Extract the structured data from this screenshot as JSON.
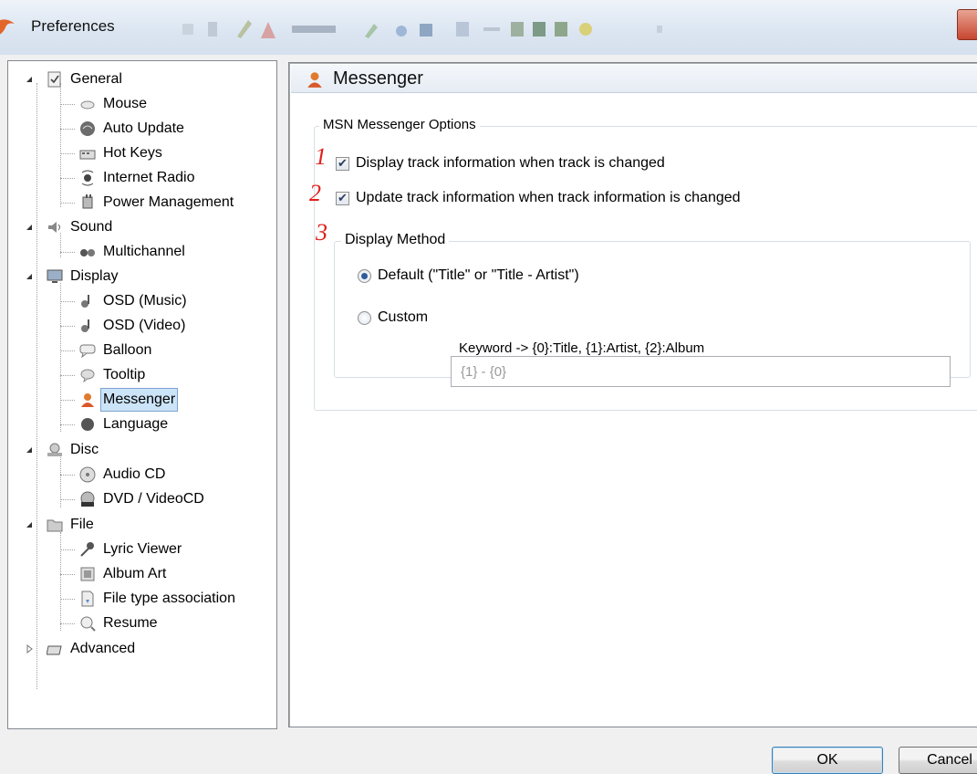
{
  "window": {
    "title": "Preferences"
  },
  "tree": {
    "general": {
      "label": "General",
      "children": [
        "Mouse",
        "Auto Update",
        "Hot Keys",
        "Internet Radio",
        "Power Management"
      ]
    },
    "sound": {
      "label": "Sound",
      "children": [
        "Multichannel"
      ]
    },
    "display": {
      "label": "Display",
      "children": [
        "OSD (Music)",
        "OSD (Video)",
        "Balloon",
        "Tooltip",
        "Messenger",
        "Language"
      ]
    },
    "disc": {
      "label": "Disc",
      "children": [
        "Audio CD",
        "DVD / VideoCD"
      ]
    },
    "file": {
      "label": "File",
      "children": [
        "Lyric Viewer",
        "Album Art",
        "File type association",
        "Resume"
      ]
    },
    "advanced": {
      "label": "Advanced"
    },
    "selected": "Messenger"
  },
  "panel": {
    "title": "Messenger",
    "group_title": "MSN Messenger Options",
    "options": [
      {
        "marker": "1",
        "label": "Display track information when track is changed",
        "checked": true
      },
      {
        "marker": "2",
        "label": "Update track information when track information is changed",
        "checked": true
      }
    ],
    "display_method": {
      "marker": "3",
      "title": "Display Method",
      "default_label": "Default (\"Title\" or \"Title - Artist\")",
      "custom_label": "Custom",
      "selected": "Default",
      "custom_value": "{1} - {0}",
      "keyword_hint": "Keyword -> {0}:Title, {1}:Artist, {2}:Album"
    }
  },
  "buttons": {
    "ok": "OK",
    "cancel": "Cancel"
  },
  "colors": {
    "annotation_red": "#e0201a",
    "selection": "#cce4f7"
  }
}
